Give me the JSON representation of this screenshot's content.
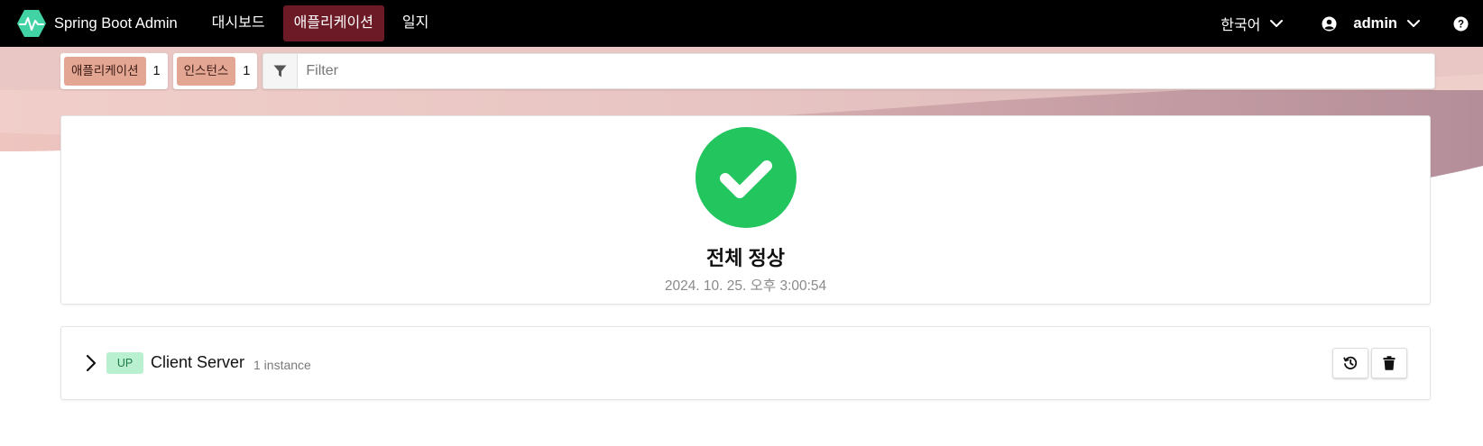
{
  "navbar": {
    "brand_name": "Spring Boot Admin",
    "items": [
      {
        "label": "대시보드",
        "active": false
      },
      {
        "label": "애플리케이션",
        "active": true
      },
      {
        "label": "일지",
        "active": false
      }
    ],
    "language": "한국어",
    "user": "admin",
    "icons": {
      "logo": "heartbeat-logo-icon",
      "user": "user-circle-icon",
      "help": "question-circle-icon"
    }
  },
  "toolbar": {
    "counters": [
      {
        "label": "애플리케이션",
        "value": "1"
      },
      {
        "label": "인스턴스",
        "value": "1"
      }
    ],
    "filter_placeholder": "Filter"
  },
  "status": {
    "title": "전체 정상",
    "timestamp": "2024. 10. 25. 오후 3:00:54",
    "color": "#22c55e"
  },
  "applications": [
    {
      "status": "UP",
      "name": "Client Server",
      "instances": "1 instance",
      "actions": [
        "history-icon",
        "trash-icon"
      ]
    }
  ],
  "colors": {
    "navbar_bg": "#000000",
    "nav_active": "#6b1a26",
    "badge_bg": "#e3a693",
    "up_badge_bg": "#b9f0cf",
    "up_badge_text": "#1c7a45"
  }
}
